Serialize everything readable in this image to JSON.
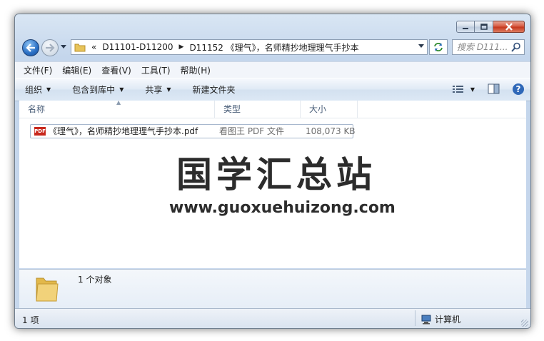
{
  "window": {
    "caption_buttons": {
      "minimize": "minimize-icon",
      "maximize": "maximize-icon",
      "close": "close-icon"
    }
  },
  "nav": {
    "history_overflow": "«",
    "breadcrumbs": [
      "D11101-D11200",
      "D11152 《理气》，名师精抄地理理气手抄本"
    ],
    "search_placeholder": "搜索 D111..."
  },
  "menu": [
    "文件(F)",
    "编辑(E)",
    "查看(V)",
    "工具(T)",
    "帮助(H)"
  ],
  "toolbar": {
    "organize": "组织",
    "include_in_library": "包含到库中",
    "share": "共享",
    "new_folder": "新建文件夹"
  },
  "columns": {
    "name": "名称",
    "type": "类型",
    "size": "大小"
  },
  "files": [
    {
      "name": "《理气》，名师精抄地理理气手抄本.pdf",
      "type": "看图王 PDF 文件",
      "size": "108,073 KB",
      "icon": "pdf-file-icon"
    }
  ],
  "watermark": {
    "title": "国学汇总站",
    "url": "www.guoxuehuizong.com"
  },
  "details_pane": {
    "count": "1 个对象"
  },
  "status": {
    "items": "1 项",
    "location": "计算机"
  },
  "colors": {
    "accent": "#2a6fc4",
    "close_button": "#c4341a",
    "pdf_red": "#c8281d",
    "folder_yellow": "#e8c45a"
  }
}
